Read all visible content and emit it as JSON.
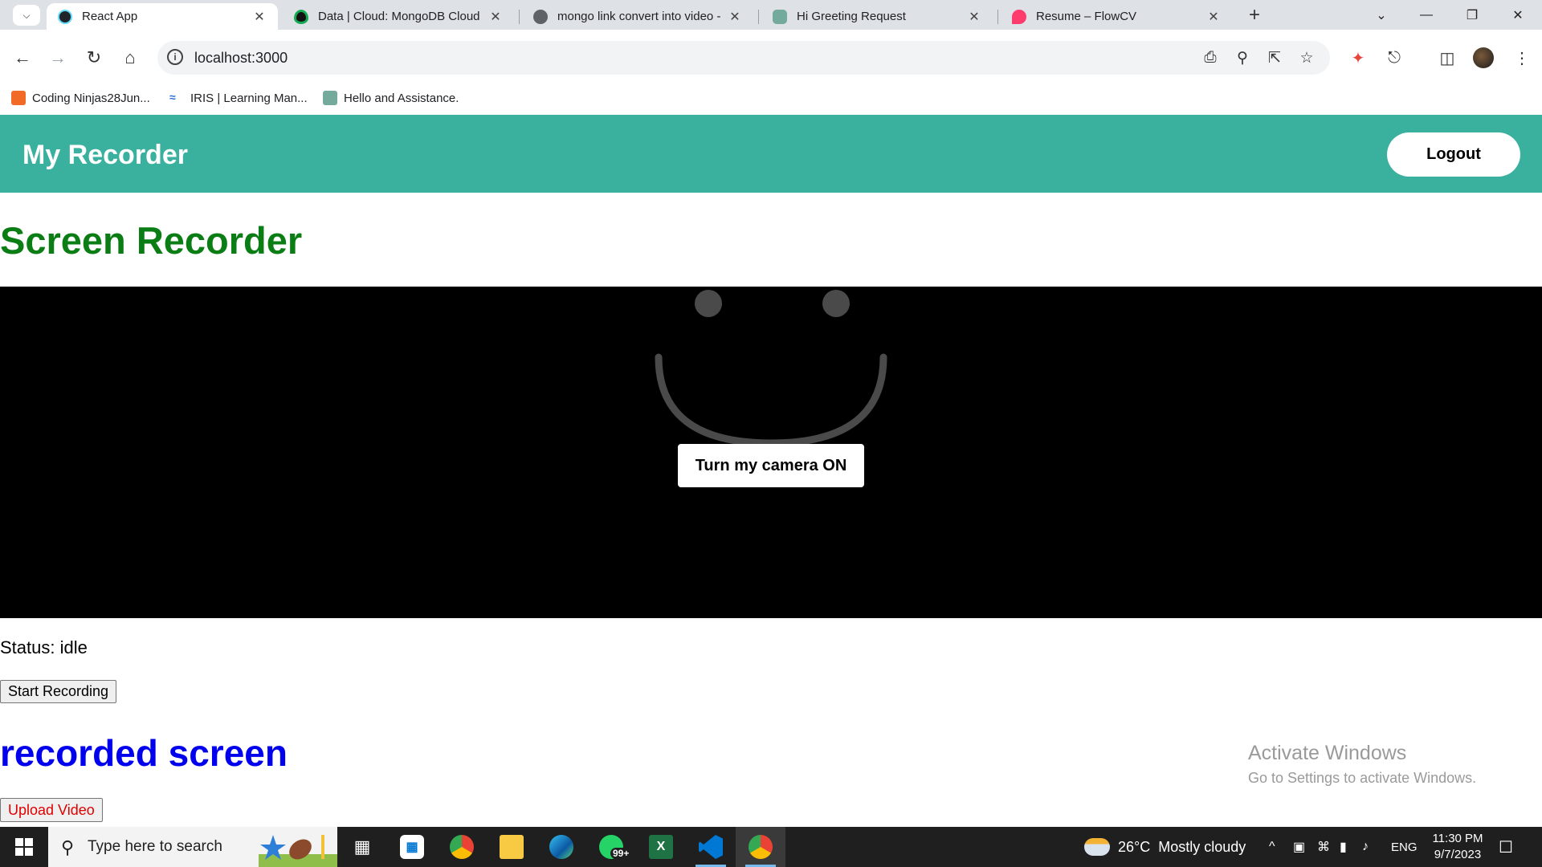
{
  "browser": {
    "tabs": [
      {
        "title": "React App",
        "active": true,
        "favicon_color": "#61dafb"
      },
      {
        "title": "Data | Cloud: MongoDB Cloud",
        "active": false,
        "favicon_color": "#13aa52"
      },
      {
        "title": "mongo link convert into video -",
        "active": false,
        "favicon_color": "#5f6368"
      },
      {
        "title": "Hi Greeting Request",
        "active": false,
        "favicon_color": "#74aa9c"
      },
      {
        "title": "Resume – FlowCV",
        "active": false,
        "favicon_color": "#ff3c6e"
      }
    ],
    "url": "localhost:3000",
    "bookmarks": [
      {
        "label": "Coding Ninjas28Jun...",
        "icon_color": "#f26b26"
      },
      {
        "label": "IRIS | Learning Man...",
        "icon_color": "#2e6fd8"
      },
      {
        "label": "Hello and Assistance.",
        "icon_color": "#74aa9c"
      }
    ]
  },
  "app": {
    "brand": "My Recorder",
    "logout_label": "Logout",
    "page_title": "Screen Recorder",
    "camera_button_label": "Turn my camera ON",
    "status_text": "Status: idle",
    "start_recording_label": "Start Recording",
    "recorded_title": "recorded screen",
    "upload_label": "Upload Video",
    "colors": {
      "header": "#3ab09e",
      "title": "#0a7d14",
      "recorded_title": "#0000ee",
      "upload_text": "#e00000"
    }
  },
  "watermark": {
    "line1": "Activate Windows",
    "line2": "Go to Settings to activate Windows."
  },
  "taskbar": {
    "search_placeholder": "Type here to search",
    "whatsapp_badge": "99+",
    "weather": "26°C  Mostly cloudy",
    "language": "ENG",
    "time": "11:30 PM",
    "date": "9/7/2023"
  }
}
